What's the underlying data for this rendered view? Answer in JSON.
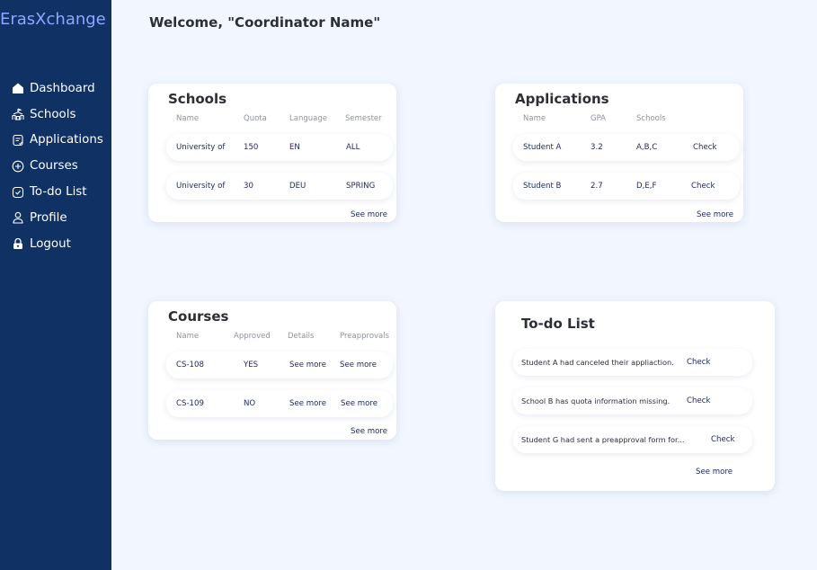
{
  "app": {
    "brand": "ErasXchange"
  },
  "nav": [
    {
      "label": "Dashboard",
      "icon": "home-icon"
    },
    {
      "label": "Schools",
      "icon": "school-icon"
    },
    {
      "label": "Applications",
      "icon": "document-icon"
    },
    {
      "label": "Courses",
      "icon": "plus-circle-icon"
    },
    {
      "label": "To-do List",
      "icon": "check-square-icon"
    },
    {
      "label": "Profile",
      "icon": "user-icon"
    },
    {
      "label": "Logout",
      "icon": "lock-icon"
    }
  ],
  "welcome": "Welcome, \"Coordinator Name\"",
  "schools": {
    "title": "Schools",
    "headers": [
      "Name",
      "Quota",
      "Language",
      "Semester"
    ],
    "rows": [
      [
        "University of",
        "150",
        "EN",
        "ALL"
      ],
      [
        "University of",
        "30",
        "DEU",
        "SPRING"
      ]
    ],
    "see_more": "See more"
  },
  "applications": {
    "title": "Applications",
    "headers": [
      "Name",
      "GPA",
      "Schools"
    ],
    "rows": [
      [
        "Student A",
        "3.2",
        "A,B,C",
        "Check"
      ],
      [
        "Student B",
        "2.7",
        "D,E,F",
        "Check"
      ]
    ],
    "see_more": "See more"
  },
  "courses": {
    "title": "Courses",
    "headers": [
      "Name",
      "Approved",
      "Details",
      "Preapprovals"
    ],
    "rows": [
      [
        "CS-108",
        "YES",
        "See more",
        "See more"
      ],
      [
        "CS-109",
        "NO",
        "See more",
        "See more"
      ]
    ],
    "see_more": "See more"
  },
  "todo": {
    "title": "To-do List",
    "items": [
      {
        "text": "Student A had canceled their appliaction.",
        "action": "Check"
      },
      {
        "text": "School B has quota information missing.",
        "action": "Check"
      },
      {
        "text": "Student G had sent a preapproval form for...",
        "action": "Check"
      }
    ],
    "see_more": "See more"
  }
}
